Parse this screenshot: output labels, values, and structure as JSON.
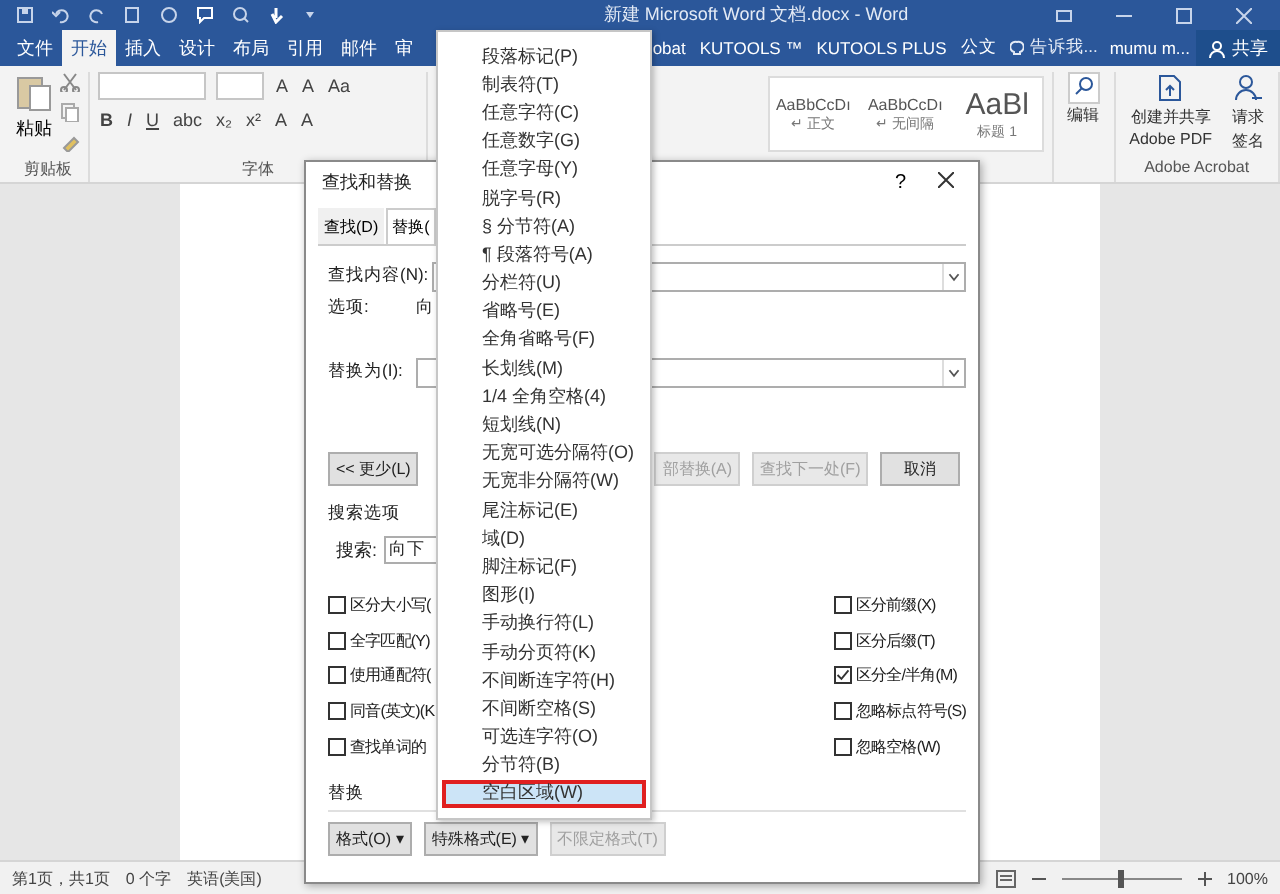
{
  "window": {
    "title": "新建 Microsoft Word 文档.docx - Word"
  },
  "ribbon_tabs": [
    {
      "label": "文件",
      "selected": false
    },
    {
      "label": "开始",
      "selected": true
    },
    {
      "label": "插入",
      "selected": false
    },
    {
      "label": "设计",
      "selected": false
    },
    {
      "label": "布局",
      "selected": false
    },
    {
      "label": "引用",
      "selected": false
    },
    {
      "label": "邮件",
      "selected": false
    },
    {
      "label": "审",
      "selected": false
    }
  ],
  "ribbon_tabs_right": [
    {
      "label": "obat",
      "selected": false
    },
    {
      "label": "KUTOOLS ™",
      "selected": false
    },
    {
      "label": "KUTOOLS PLUS",
      "selected": false
    },
    {
      "label": "公文",
      "selected": false
    }
  ],
  "tell_me": "告诉我...",
  "user": "mumu m...",
  "share": "共享",
  "ribbon": {
    "paste": "粘贴",
    "clipboard_label": "剪贴板",
    "font_label": "字体",
    "font_tools": [
      "A",
      "A",
      "Aa",
      "B",
      "I",
      "U",
      "abc",
      "x₂",
      "x²",
      "A",
      "A"
    ],
    "styles": [
      {
        "sample": "AaBbCcDı",
        "name": "↵ 正文"
      },
      {
        "sample": "AaBbCcDı",
        "name": "↵ 无间隔"
      },
      {
        "sample": "AaBl",
        "name": "标题 1"
      }
    ],
    "editing": "编辑",
    "acrobat_buttons": [
      {
        "lines": [
          "创建并共享",
          "Adobe PDF"
        ]
      },
      {
        "lines": [
          "请求",
          "签名"
        ]
      }
    ],
    "acrobat_label": "Adobe Acrobat"
  },
  "dialog": {
    "title": "查找和替换",
    "help": "?",
    "tabs": [
      {
        "label": "查找(D)",
        "selected": false
      },
      {
        "label": "替换(",
        "selected": true
      }
    ],
    "find_label": "查找内容(N):",
    "options_label": "选项:",
    "options_value": "向",
    "replace_label": "替换为(I):",
    "more_button": "<< 更少(L)",
    "action_buttons": [
      {
        "label": "部替换(A)",
        "disabled": true
      },
      {
        "label": "查找下一处(F)",
        "disabled": true
      },
      {
        "label": "取消",
        "disabled": false
      }
    ],
    "search_options_label": "搜索选项",
    "search_label": "搜索:",
    "search_value": "向下",
    "left_checks": [
      {
        "label": "区分大小写(",
        "checked": false
      },
      {
        "label": "全字匹配(Y)",
        "checked": false
      },
      {
        "label": "使用通配符(",
        "checked": false
      },
      {
        "label": "同音(英文)(K",
        "checked": false
      },
      {
        "label": "查找单词的",
        "checked": false
      }
    ],
    "right_checks": [
      {
        "label": "区分前缀(X)",
        "checked": false
      },
      {
        "label": "区分后缀(T)",
        "checked": false
      },
      {
        "label": "区分全/半角(M)",
        "checked": true
      },
      {
        "label": "忽略标点符号(S)",
        "checked": false
      },
      {
        "label": "忽略空格(W)",
        "checked": false
      }
    ],
    "replace_section_label": "替换",
    "bottom_buttons": [
      {
        "label": "格式(O) ▾",
        "disabled": false
      },
      {
        "label": "特殊格式(E) ▾",
        "disabled": false
      },
      {
        "label": "不限定格式(T)",
        "disabled": true
      }
    ]
  },
  "special_menu": [
    {
      "label": "段落标记(P)",
      "selected": false
    },
    {
      "label": "制表符(T)",
      "selected": false
    },
    {
      "label": "任意字符(C)",
      "selected": false
    },
    {
      "label": "任意数字(G)",
      "selected": false
    },
    {
      "label": "任意字母(Y)",
      "selected": false
    },
    {
      "label": "脱字号(R)",
      "selected": false
    },
    {
      "label": "§ 分节符(A)",
      "selected": false
    },
    {
      "label": "¶ 段落符号(A)",
      "selected": false
    },
    {
      "label": "分栏符(U)",
      "selected": false
    },
    {
      "label": "省略号(E)",
      "selected": false
    },
    {
      "label": "全角省略号(F)",
      "selected": false
    },
    {
      "label": "长划线(M)",
      "selected": false
    },
    {
      "label": "1/4 全角空格(4)",
      "selected": false
    },
    {
      "label": "短划线(N)",
      "selected": false
    },
    {
      "label": "无宽可选分隔符(O)",
      "selected": false
    },
    {
      "label": "无宽非分隔符(W)",
      "selected": false
    },
    {
      "label": "尾注标记(E)",
      "selected": false
    },
    {
      "label": "域(D)",
      "selected": false
    },
    {
      "label": "脚注标记(F)",
      "selected": false
    },
    {
      "label": "图形(I)",
      "selected": false
    },
    {
      "label": "手动换行符(L)",
      "selected": false
    },
    {
      "label": "手动分页符(K)",
      "selected": false
    },
    {
      "label": "不间断连字符(H)",
      "selected": false
    },
    {
      "label": "不间断空格(S)",
      "selected": false
    },
    {
      "label": "可选连字符(O)",
      "selected": false
    },
    {
      "label": "分节符(B)",
      "selected": false
    },
    {
      "label": "空白区域(W)",
      "selected": true
    }
  ],
  "status_bar": {
    "items": [
      "第1页，共1页",
      "0 个字",
      "英语(美国)"
    ],
    "zoom": {
      "level": 0.5
    },
    "zoom_text": "100%"
  }
}
